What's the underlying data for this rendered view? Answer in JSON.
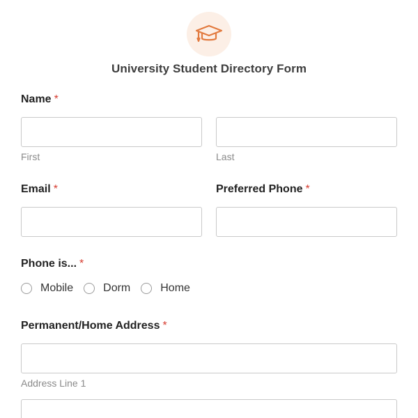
{
  "header": {
    "icon": "graduation-cap-icon",
    "title": "University Student Directory Form"
  },
  "colors": {
    "accent": "#e27a3f",
    "icon_background": "#fcefe6",
    "required": "#d63b2f"
  },
  "fields": {
    "name": {
      "label": "Name",
      "required_mark": "*",
      "first": {
        "value": "",
        "sublabel": "First"
      },
      "last": {
        "value": "",
        "sublabel": "Last"
      }
    },
    "email": {
      "label": "Email",
      "required_mark": "*",
      "value": ""
    },
    "preferred_phone": {
      "label": "Preferred Phone",
      "required_mark": "*",
      "value": ""
    },
    "phone_is": {
      "label": "Phone is...",
      "required_mark": "*",
      "options": [
        "Mobile",
        "Dorm",
        "Home"
      ]
    },
    "address": {
      "label": "Permanent/Home Address",
      "required_mark": "*",
      "line1": {
        "value": "",
        "sublabel": "Address Line 1"
      },
      "line2": {
        "value": ""
      }
    }
  }
}
